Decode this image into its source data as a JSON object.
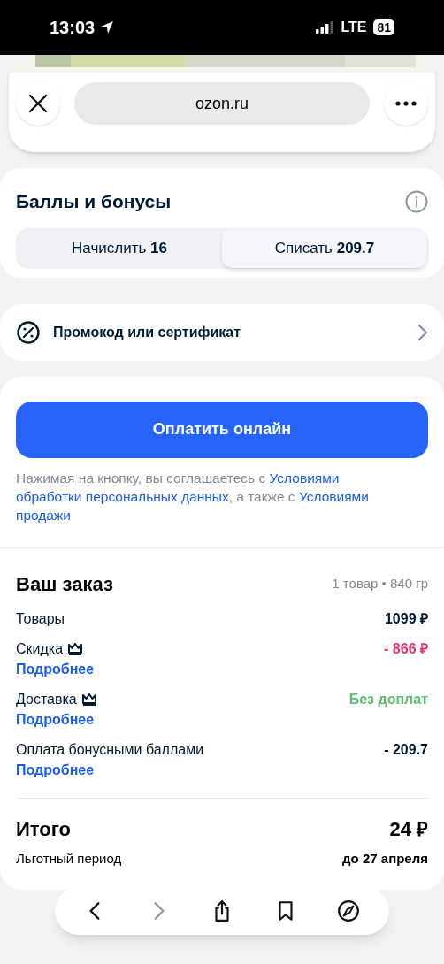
{
  "status_bar": {
    "time": "13:03",
    "network": "LTE",
    "battery": "81"
  },
  "browser": {
    "url": "ozon.ru"
  },
  "bonuses": {
    "title": "Баллы и бонусы",
    "tabs": [
      {
        "label": "Начислить **16**",
        "selected": false
      },
      {
        "label": "Списать **209.7**",
        "selected": true
      }
    ]
  },
  "promo": {
    "label": "Промокод или сертификат"
  },
  "pay_button": "Оплатить онлайн",
  "terms": [
    {
      "text": "Нажимая на кнопку, вы соглашаетесь с ",
      "kind": "text"
    },
    {
      "text": "Условиями",
      "kind": "link"
    },
    {
      "text": "обработки персональных данных",
      "kind": "link"
    },
    {
      "text": ", а также с ",
      "kind": "text"
    },
    {
      "text": "Условиями",
      "kind": "link"
    },
    {
      "text": "продажи",
      "kind": "link"
    }
  ],
  "order": {
    "title": "Ваш заказ",
    "summary": "1 товар • 840 гр",
    "rows": [
      {
        "label": "Товары",
        "premium": false,
        "value": "1099 ₽",
        "color": "#001a34"
      },
      {
        "label": "Скидка",
        "premium": true,
        "link": "Подробнее",
        "value": "- 866 ₽",
        "color": "#e8336e"
      },
      {
        "label": "Доставка",
        "premium": true,
        "link": "Подробнее",
        "value": "Без доплат",
        "color": "#5cbd6c"
      },
      {
        "label": "Оплата бонусными баллами",
        "premium": false,
        "link": "Подробнее",
        "value": "- 209.7",
        "color": "#001a34"
      }
    ],
    "total_label": "Итого",
    "total_value": "24 ₽",
    "period_label": "Льготный период",
    "period_value": "до 27 апреля"
  },
  "toolbar": [
    {
      "kind": "back",
      "disabled": false
    },
    {
      "kind": "forward",
      "disabled": true
    },
    {
      "kind": "share",
      "disabled": false
    },
    {
      "kind": "bookmarks",
      "disabled": false
    },
    {
      "kind": "compass",
      "disabled": false
    }
  ]
}
